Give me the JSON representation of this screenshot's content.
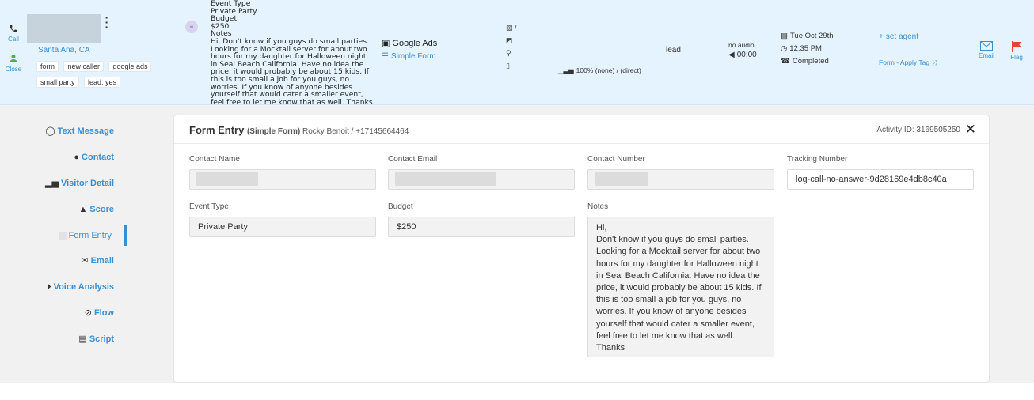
{
  "top": {
    "call_label": "Call",
    "close_label": "Close",
    "location": "Santa Ana, CA",
    "tags": [
      "form",
      "new caller",
      "google ads",
      "small party",
      "lead: yes"
    ],
    "notes_lines": [
      "Event Type",
      "Private Party",
      "Budget",
      "$250",
      "Notes",
      "Hi, Don't know if you guys do small parties.",
      "Looking for a Mocktail server for about two",
      "hours for my daughter for Halloween night",
      "in Seal Beach California. Have no idea the",
      "price, it would probably be about 15 kids. If",
      "this is too small a job for you guys, no",
      "worries. If you know of anyone besides",
      "yourself that would cater a smaller event,",
      "feel free to let me know that as well. Thanks"
    ],
    "source": "Google Ads",
    "source_sub": "Simple Form",
    "device_slash": "/",
    "percent": "100% (none) / (direct)",
    "status": "lead",
    "audio": "no audio",
    "duration": "00:00",
    "date": "Tue Oct 29th",
    "time": "12:35 PM",
    "state": "Completed",
    "set_agent": "set agent",
    "apply_tag": "Form - Apply Tag",
    "email_label": "Email",
    "flag_label": "Flag",
    "colors": {
      "accent": "#3a8fd0",
      "flag": "#e0463c",
      "call_green": "#4caf50"
    }
  },
  "nav": {
    "items": [
      {
        "label": "Text Message",
        "icon": "chat-icon"
      },
      {
        "label": "Contact",
        "icon": "user-icon"
      },
      {
        "label": "Visitor Detail",
        "icon": "bar-chart-icon"
      },
      {
        "label": "Score",
        "icon": "score-icon"
      },
      {
        "label": "Form Entry",
        "icon": "form-icon"
      },
      {
        "label": "Email",
        "icon": "envelope-icon"
      },
      {
        "label": "Voice Analysis",
        "icon": "play-circle-icon"
      },
      {
        "label": "Flow",
        "icon": "flow-icon"
      },
      {
        "label": "Script",
        "icon": "document-icon"
      }
    ],
    "active_index": 4
  },
  "form": {
    "title": "Form Entry",
    "form_name": "(Simple Form)",
    "contact_line": "Rocky Benoit / +17145664464",
    "activity_id": "Activity ID: 3169505250",
    "fields": {
      "contact_name_label": "Contact Name",
      "contact_email_label": "Contact Email",
      "contact_number_label": "Contact Number",
      "tracking_number_label": "Tracking Number",
      "tracking_number_value": "log-call-no-answer-9d28169e4db8c40a",
      "event_type_label": "Event Type",
      "event_type_value": "Private Party",
      "budget_label": "Budget",
      "budget_value": "$250",
      "notes_label": "Notes"
    },
    "notes_lines": [
      "Hi,",
      "Don't know if you guys do small parties.",
      "Looking for a Mocktail server for about two",
      "hours for my daughter for Halloween night",
      "in Seal Beach California. Have no idea the",
      "price, it would probably be about 15 kids. If",
      "this is too small a job for you guys, no",
      "worries. If you know of anyone besides",
      "yourself that would cater a smaller event,",
      "feel free to let me know that as well.",
      "Thanks"
    ]
  }
}
